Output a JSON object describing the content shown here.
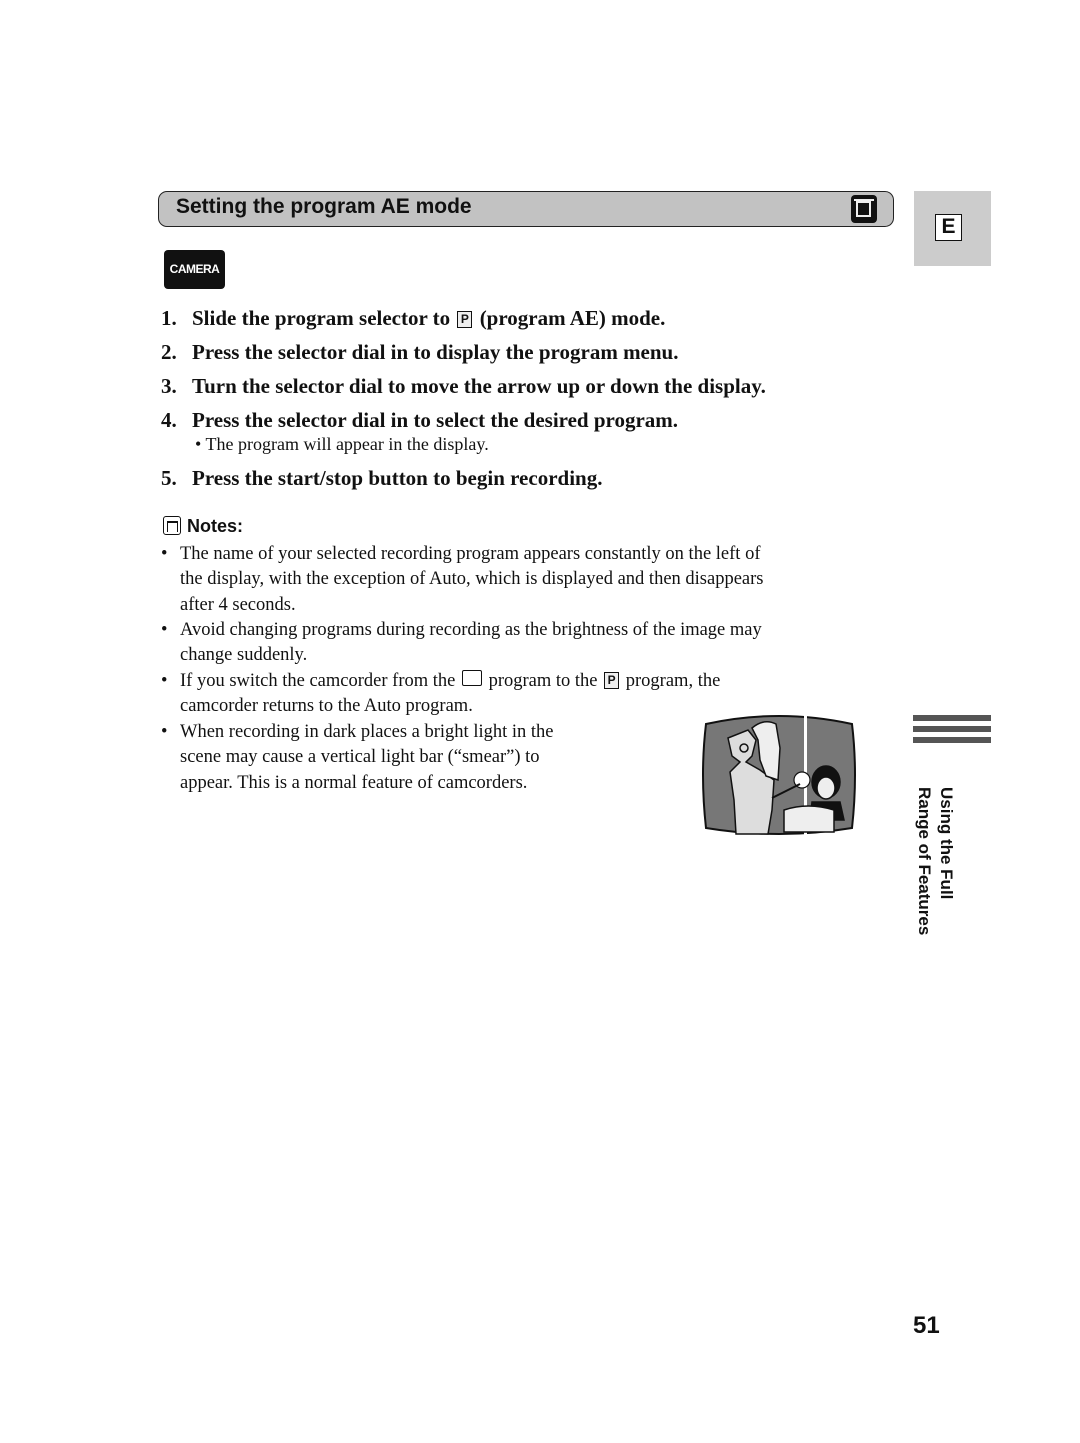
{
  "section": {
    "title": "Setting the program AE mode",
    "icon": "program-ae-mode-icon"
  },
  "language_tab": "E",
  "camera_badge": "CAMERA",
  "steps": [
    {
      "num": "1.",
      "before": "Slide the program selector to",
      "symbol": "P",
      "after": "(program AE) mode."
    },
    {
      "num": "2.",
      "text": "Press the selector dial in to display the program menu."
    },
    {
      "num": "3.",
      "text": "Turn the selector dial to move the arrow up or down the display."
    },
    {
      "num": "4.",
      "text": "Press the selector dial in to select the desired program."
    },
    {
      "num": "5.",
      "text": "Press the start/stop button to begin recording."
    }
  ],
  "step4_sub": "• The program will appear in the display.",
  "notes": {
    "heading": "Notes:",
    "bullet": "•",
    "items": [
      {
        "lines": [
          "The name of your selected recording program appears constantly on the left of",
          "the display, with the exception of Auto, which is displayed and then disappears",
          "after 4 seconds."
        ]
      },
      {
        "lines": [
          "Avoid changing programs during recording as the brightness of the image may",
          "change suddenly."
        ]
      },
      {
        "line1_a": "If you switch the camcorder from the",
        "line1_b": "program to the",
        "symbol": "P",
        "line1_c": "program, the",
        "line2": "camcorder returns to the Auto program."
      },
      {
        "lines": [
          "When recording in dark places a bright light in the",
          "scene may cause a vertical light bar (“smear”) to",
          "appear. This is a normal feature of camcorders."
        ]
      }
    ]
  },
  "illustration": "smear-example-illustration",
  "side_label": [
    "Using the Full",
    "Range of Features"
  ],
  "page_number": "51"
}
